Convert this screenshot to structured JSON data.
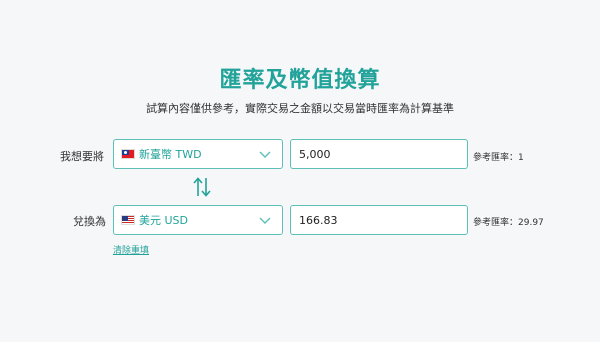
{
  "header": {
    "title": "匯率及幣值換算",
    "subtitle": "試算內容僅供參考，實際交易之金額以交易當時匯率為計算基準"
  },
  "from": {
    "label": "我想要將",
    "currency": "新臺幣 TWD",
    "flag": "taiwan-flag",
    "amount": "5,000",
    "rate_text": "參考匯率：1"
  },
  "to": {
    "label": "兌換為",
    "currency": "美元 USD",
    "flag": "us-flag",
    "amount": "166.83",
    "rate_text": "參考匯率：29.97"
  },
  "actions": {
    "clear": "清除重填"
  },
  "colors": {
    "accent": "#22a39a",
    "border": "#5dbfb6",
    "background": "#f6f7f9"
  }
}
